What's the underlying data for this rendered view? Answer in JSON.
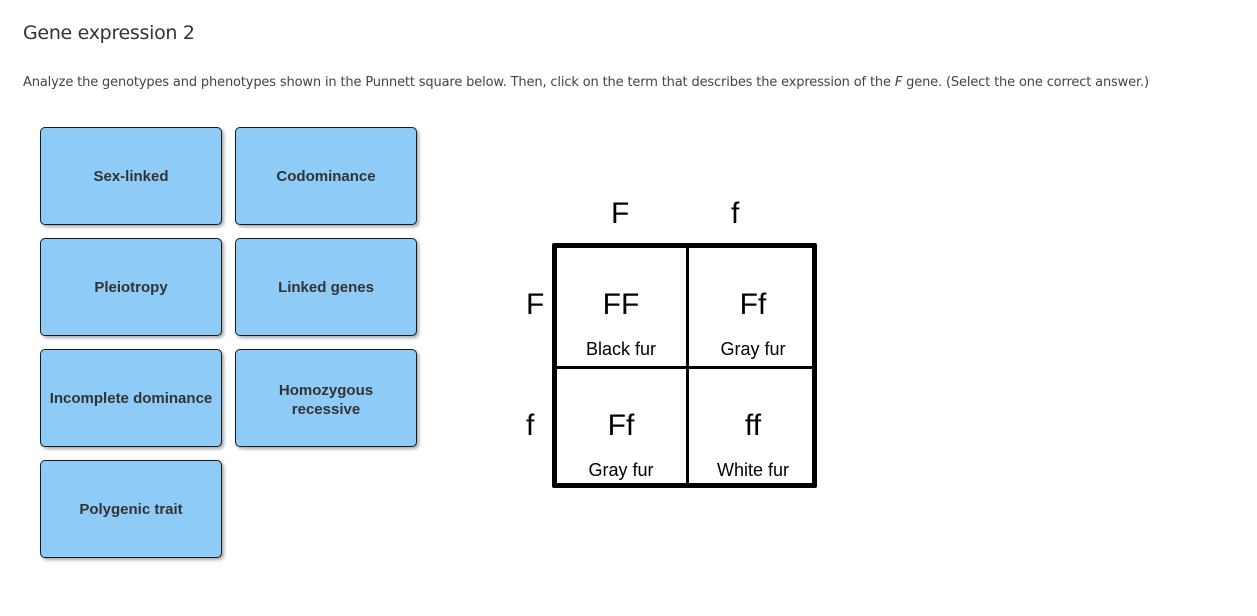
{
  "page": {
    "title": "Gene expression 2",
    "instructions": {
      "before": "Analyze the genotypes and phenotypes shown in the Punnett square below. Then, click on the term that describes the expression of the ",
      "gene": "F",
      "after": " gene. (Select the one correct answer.)"
    }
  },
  "choices": [
    {
      "label": "Sex-linked"
    },
    {
      "label": "Codominance"
    },
    {
      "label": "Pleiotropy"
    },
    {
      "label": "Linked genes"
    },
    {
      "label": "Incomplete dominance"
    },
    {
      "label": "Homozygous\nrecessive"
    },
    {
      "label": "Polygenic trait"
    }
  ],
  "punnett": {
    "top_alleles": [
      "F",
      "f"
    ],
    "side_alleles": [
      "F",
      "f"
    ],
    "cells": [
      {
        "genotype": "FF",
        "phenotype": "Black fur"
      },
      {
        "genotype": "Ff",
        "phenotype": "Gray fur"
      },
      {
        "genotype": "Ff",
        "phenotype": "Gray fur"
      },
      {
        "genotype": "ff",
        "phenotype": "White fur"
      }
    ]
  },
  "colors": {
    "choice_fill": "#8ecbf6",
    "choice_border": "#1a1a1a",
    "text": "#333333"
  }
}
